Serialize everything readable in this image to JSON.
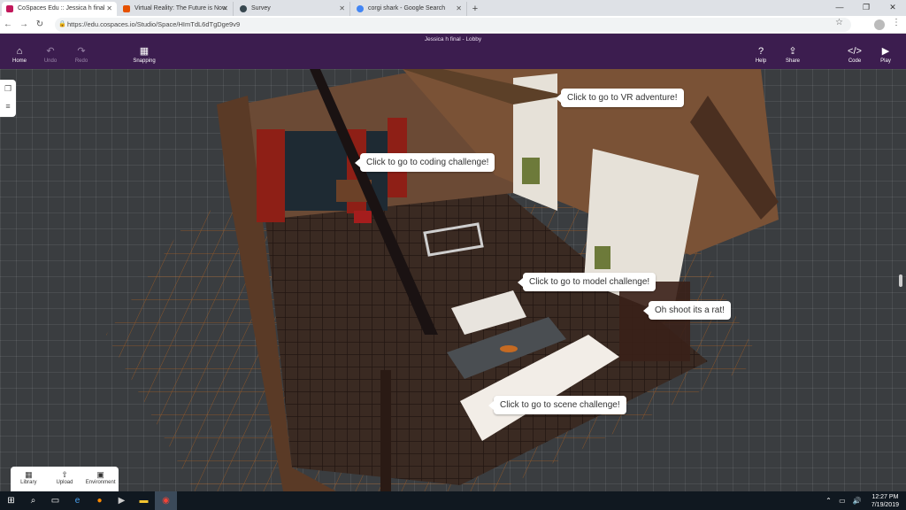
{
  "browser": {
    "tabs": [
      {
        "label": "CoSpaces Edu :: Jessica h final",
        "favicon_color": "#c2185b",
        "active": true
      },
      {
        "label": "Virtual Reality: The Future is Now",
        "favicon_color": "#e65100",
        "active": false
      },
      {
        "label": "Survey",
        "favicon_color": "#37474f",
        "active": false
      },
      {
        "label": "corgi shark - Google Search",
        "favicon_color": "#4285f4",
        "active": false
      }
    ],
    "new_tab": "+",
    "url": "https://edu.cospaces.io/Studio/Space/HImTdL6dTgDge9v9"
  },
  "app": {
    "title": "Jessica h final - Lobby",
    "toolbar": {
      "home": "Home",
      "undo": "Undo",
      "redo": "Redo",
      "snapping": "Snapping",
      "help": "Help",
      "share": "Share",
      "code": "Code",
      "play": "Play"
    },
    "bottom_tools": {
      "library": "Library",
      "upload": "Upload",
      "environment": "Environment"
    },
    "accent": "#3c1d4f"
  },
  "scene": {
    "bubbles": {
      "vr": "Click to go to VR adventure!",
      "coding": "Click to go to coding challenge!",
      "model": "Click to go to model challenge!",
      "rat": "Oh shoot its a rat!",
      "scene": "Click to go to scene challenge!"
    }
  },
  "taskbar": {
    "time": "12:27 PM",
    "date": "7/19/2019"
  }
}
